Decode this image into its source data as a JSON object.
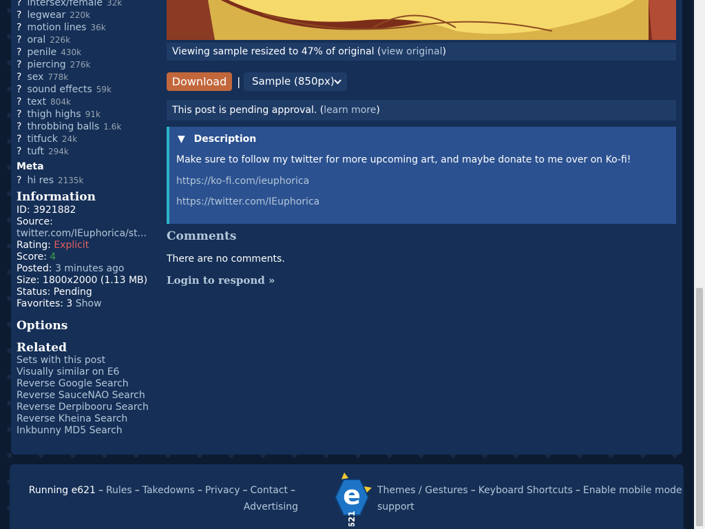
{
  "sidebar": {
    "tags": [
      {
        "name": "intersex/female",
        "count": "32k"
      },
      {
        "name": "legwear",
        "count": "220k"
      },
      {
        "name": "motion lines",
        "count": "36k"
      },
      {
        "name": "oral",
        "count": "226k"
      },
      {
        "name": "penile",
        "count": "430k"
      },
      {
        "name": "piercing",
        "count": "276k"
      },
      {
        "name": "sex",
        "count": "778k"
      },
      {
        "name": "sound effects",
        "count": "59k"
      },
      {
        "name": "text",
        "count": "804k"
      },
      {
        "name": "thigh highs",
        "count": "91k"
      },
      {
        "name": "throbbing balls",
        "count": "1.6k"
      },
      {
        "name": "titfuck",
        "count": "24k"
      },
      {
        "name": "tuft",
        "count": "294k"
      }
    ],
    "tag_marker": "?",
    "meta_heading": "Meta",
    "meta_tags": [
      {
        "name": "hi res",
        "count": "2135k"
      }
    ],
    "information_heading": "Information",
    "info": {
      "id": "ID: 3921882",
      "source_label": "Source:",
      "source_link": "twitter.com/IEuphorica/st...",
      "rating_label": "Rating: ",
      "rating_value": "Explicit",
      "score_label": "Score: ",
      "score_value": "4",
      "posted_label": "Posted: ",
      "posted_value": "3 minutes ago",
      "size": "Size: 1800x2000 (1.13 MB)",
      "status": "Status: Pending",
      "favorites_label": "Favorites: 3 ",
      "favorites_show": "Show"
    },
    "options_heading": "Options",
    "related_heading": "Related",
    "related_links": [
      "Sets with this post",
      "Visually similar on E6",
      "Reverse Google Search",
      "Reverse SauceNAO Search",
      "Reverse Derpibooru Search",
      "Reverse Kheina Search",
      "Inkbunny MD5 Search"
    ]
  },
  "content": {
    "resize_text": "Viewing sample resized to 47% of original (",
    "view_original": "view original",
    "resize_close": ")",
    "download_label": "Download",
    "separator": "|",
    "sample_option": "Sample (850px)",
    "pending_text": "This post is pending approval. (",
    "learn_more": "learn more",
    "pending_close": ")",
    "description_heading": "Description",
    "description_toggle": "▼",
    "description_text": "Make sure to follow my twitter for more upcoming art, and maybe donate to me over on Ko-fi!",
    "description_link1": "https://ko-fi.com/ieuphorica",
    "description_link2": "https://twitter.com/IEuphorica",
    "comments_heading": "Comments",
    "no_comments": "There are no comments.",
    "login_respond": "Login to respond »"
  },
  "footer": {
    "running": "Running e621",
    "rules": "Rules",
    "takedowns": "Takedowns",
    "privacy": "Privacy",
    "contact": "Contact",
    "advertising": "Advertising",
    "themes": "Themes / Gestures",
    "keyboard": "Keyboard Shortcuts",
    "mobile": "Enable mobile mode",
    "support": "support",
    "dash": "–",
    "logo_text": "e",
    "logo_sub": "621"
  },
  "colors": {
    "background": "#0c1b30",
    "panel": "#152f56",
    "link": "#b4c7d9",
    "explicit": "#e45f5f",
    "score": "#3e9e49",
    "download": "#c2673b",
    "description_border": "#2ab5c8"
  }
}
